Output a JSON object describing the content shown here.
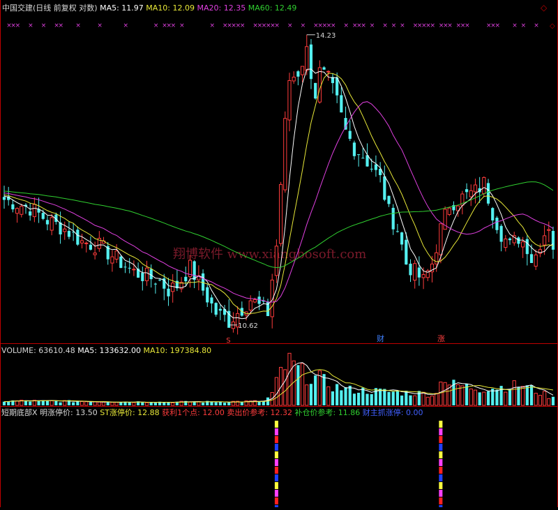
{
  "colors": {
    "bg": "#000000",
    "up": "#ff3c3c",
    "down": "#54f0f0",
    "ma5": "#ffffff",
    "ma10": "#e8e838",
    "ma20": "#e040e0",
    "ma60": "#30d030",
    "axis": "#c00000",
    "marker": "#e040e0",
    "watermark": "#7a1a2a",
    "finance": "#4080ff",
    "zhang": "#ff4040"
  },
  "main_panel": {
    "title_parts": [
      {
        "text": "中国交建(日线 前复权 对数)",
        "color": "#d8d8d8"
      },
      {
        "text": "MA5: 11.97",
        "color": "#ffffff"
      },
      {
        "text": "MA10: 12.09",
        "color": "#e8e838"
      },
      {
        "text": "MA20: 12.35",
        "color": "#e040e0"
      },
      {
        "text": "MA60: 12.49",
        "color": "#30d030"
      }
    ],
    "top_marker_glyph": "×",
    "high_label": "14.23",
    "low_label": "10.62",
    "s_label": "S",
    "finance_label": "财",
    "zhang_label": "涨",
    "watermark": "翔博软件 www.xiangbosoft.com"
  },
  "volume_panel": {
    "title_parts": [
      {
        "text": "VOLUME: 63610.48",
        "color": "#d8d8d8"
      },
      {
        "text": "MA5: 133632.00",
        "color": "#ffffff"
      },
      {
        "text": "MA10: 197384.80",
        "color": "#e8e838"
      }
    ]
  },
  "indicator_panel": {
    "title_parts": [
      {
        "text": "短期底部X",
        "color": "#d8d8d8"
      },
      {
        "text": "明涨停价: 13.50",
        "color": "#d8d8d8"
      },
      {
        "text": "ST涨停价: 12.88",
        "color": "#e8e838"
      },
      {
        "text": "获利1个点: 12.00",
        "color": "#ff3c3c"
      },
      {
        "text": "卖出价参考: 12.32",
        "color": "#ff3c3c"
      },
      {
        "text": "补仓价参考: 11.86",
        "color": "#30d030"
      },
      {
        "text": "财主抓涨停: 0.00",
        "color": "#4060ff"
      }
    ],
    "stripe_colors": [
      "#ffff40",
      "#ff40ff",
      "#ff2020",
      "#2040ff"
    ]
  },
  "chart_data": {
    "type": "candlestick",
    "scale": "log",
    "price_range": [
      10.5,
      14.45
    ],
    "volume_range": [
      0,
      430000
    ],
    "close_anchors": [
      [
        0,
        12.05
      ],
      [
        3,
        12.0
      ],
      [
        6,
        11.95
      ],
      [
        10,
        11.8
      ],
      [
        14,
        11.7
      ],
      [
        18,
        11.55
      ],
      [
        22,
        11.5
      ],
      [
        26,
        11.35
      ],
      [
        30,
        11.2
      ],
      [
        33,
        11.15
      ],
      [
        36,
        11.1
      ],
      [
        38,
        11.0
      ],
      [
        40,
        11.05
      ],
      [
        43,
        11.25
      ],
      [
        46,
        11.0
      ],
      [
        49,
        10.75
      ],
      [
        51,
        10.7
      ],
      [
        52,
        10.66
      ],
      [
        55,
        10.8
      ],
      [
        57,
        10.9
      ],
      [
        59,
        10.82
      ],
      [
        61,
        10.75
      ],
      [
        63,
        11.5
      ],
      [
        65,
        13.0
      ],
      [
        66,
        13.6
      ],
      [
        68,
        13.7
      ],
      [
        70,
        14.0
      ],
      [
        72,
        13.4
      ],
      [
        73,
        13.7
      ],
      [
        75,
        13.6
      ],
      [
        77,
        13.3
      ],
      [
        79,
        12.9
      ],
      [
        81,
        12.7
      ],
      [
        83,
        12.6
      ],
      [
        85,
        12.45
      ],
      [
        87,
        12.3
      ],
      [
        89,
        11.9
      ],
      [
        91,
        11.7
      ],
      [
        93,
        11.3
      ],
      [
        95,
        11.2
      ],
      [
        97,
        11.1
      ],
      [
        99,
        11.3
      ],
      [
        101,
        11.7
      ],
      [
        103,
        12.0
      ],
      [
        105,
        12.05
      ],
      [
        107,
        12.1
      ],
      [
        109,
        12.15
      ],
      [
        111,
        12.25
      ],
      [
        113,
        11.9
      ],
      [
        115,
        11.65
      ],
      [
        117,
        11.5
      ],
      [
        119,
        11.6
      ],
      [
        121,
        11.5
      ],
      [
        122,
        11.35
      ],
      [
        123,
        11.4
      ],
      [
        124,
        11.55
      ],
      [
        125,
        11.65
      ],
      [
        126,
        11.75
      ],
      [
        127,
        11.5
      ]
    ],
    "volume_profile": [
      [
        0,
        40000
      ],
      [
        20,
        35000
      ],
      [
        40,
        30000
      ],
      [
        60,
        35000
      ],
      [
        62,
        100000
      ],
      [
        64,
        300000
      ],
      [
        66,
        380000
      ],
      [
        68,
        320000
      ],
      [
        70,
        260000
      ],
      [
        73,
        240000
      ],
      [
        76,
        170000
      ],
      [
        80,
        140000
      ],
      [
        85,
        130000
      ],
      [
        90,
        120000
      ],
      [
        95,
        110000
      ],
      [
        100,
        100000
      ],
      [
        101,
        270000
      ],
      [
        103,
        190000
      ],
      [
        110,
        150000
      ],
      [
        120,
        180000
      ],
      [
        127,
        64000
      ]
    ],
    "signal_bars": [
      63,
      101
    ],
    "top_markers": [
      1,
      2,
      3,
      6,
      9,
      12,
      13,
      17,
      22,
      28,
      35,
      37,
      38,
      39,
      41,
      48,
      51,
      52,
      53,
      54,
      55,
      58,
      59,
      60,
      61,
      62,
      63,
      66,
      69,
      72,
      73,
      74,
      75,
      76,
      79,
      81,
      82,
      83,
      85,
      88,
      90,
      92,
      95,
      96,
      97,
      98,
      99,
      101,
      102,
      103,
      105,
      106,
      107,
      112,
      113,
      114,
      118,
      120,
      123
    ]
  }
}
